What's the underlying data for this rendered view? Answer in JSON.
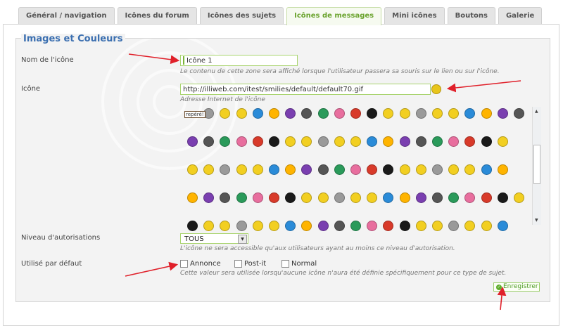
{
  "tabs": [
    {
      "label": "Général / navigation",
      "active": false
    },
    {
      "label": "Icônes du forum",
      "active": false
    },
    {
      "label": "Icônes des sujets",
      "active": false
    },
    {
      "label": "Icônes de messages",
      "active": true
    },
    {
      "label": "Mini icônes",
      "active": false
    },
    {
      "label": "Boutons",
      "active": false
    },
    {
      "label": "Galerie",
      "active": false
    }
  ],
  "section": {
    "title": "Images et Couleurs"
  },
  "name_field": {
    "label": "Nom de l'icône",
    "value": "Icône 1",
    "help": "Le contenu de cette zone sera affiché lorsque l'utilisateur passera sa souris sur le lien ou sur l'icône."
  },
  "icon_field": {
    "label": "Icône",
    "value": "http://illiweb.com/itest/smilies/default/default70.gif",
    "help": "Adresse Internet de l'icône",
    "sign_text": "repéré!"
  },
  "permission_field": {
    "label": "Niveau d'autorisations",
    "selected": "TOUS",
    "help": "L'icône ne sera accessible qu'aux utilisateurs ayant au moins ce niveau d'autorisation."
  },
  "default_field": {
    "label": "Utilisé par défaut",
    "options": [
      "Annonce",
      "Post-it",
      "Normal"
    ],
    "help": "Cette valeur sera utilisée lorsqu'aucune icône n'aura été définie spécifiquement pour ce type de sujet."
  },
  "save_button": {
    "label": "Enregistrer"
  },
  "colors": {
    "accent": "#6aa32d",
    "title": "#3b6fb0",
    "arrow": "#e0202a",
    "smiley": "#f2cf21"
  }
}
